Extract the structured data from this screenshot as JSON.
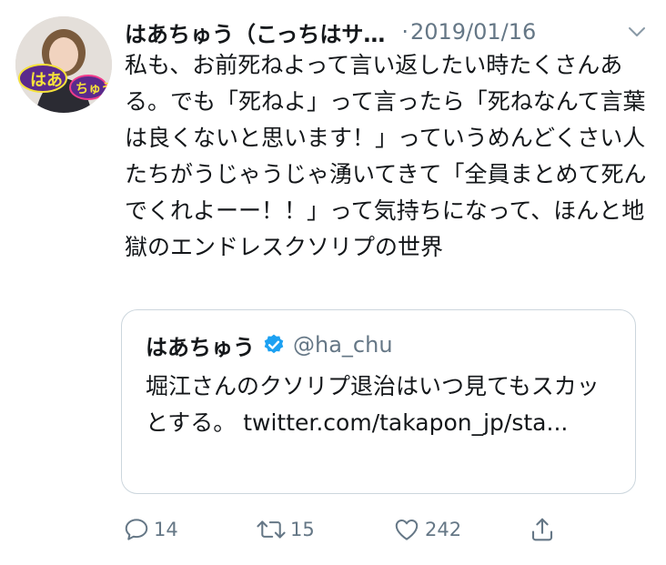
{
  "tweet": {
    "display_name": "はあちゅう（こっちはサ…",
    "date": "2019/01/16",
    "dot": "·",
    "text": "私も、お前死ねよって言い返したい時たくさんある。でも「死ねよ」って言ったら「死ねなんて言葉は良くないと思います！」っていうめんどくさい人たちがうじゃうじゃ湧いてきて「全員まとめて死んでくれよーー！！」って気持ちになって、ほんと地獄のエンドレスクソリプの世界",
    "avatar_sign_text": "はあちゅう",
    "menu_icon": "chevron-down-icon"
  },
  "quote": {
    "name": "はあちゅう",
    "handle": "@ha_chu",
    "verified": true,
    "text": "堀江さんのクソリプ退治はいつ見てもスカッとする。 twitter.com/takapon_jp/sta..."
  },
  "actions": {
    "reply": {
      "icon": "reply-icon",
      "count": "14"
    },
    "retweet": {
      "icon": "retweet-icon",
      "count": "15"
    },
    "like": {
      "icon": "heart-icon",
      "count": "242"
    },
    "share": {
      "icon": "share-icon"
    }
  },
  "colors": {
    "text": "#14171a",
    "secondary": "#657786",
    "border": "#ccd6dd",
    "verified": "#1da1f2",
    "sign_purple": "#5a2a8c",
    "sign_yellow": "#f5e23a",
    "sign_pink": "#f03c8c"
  }
}
